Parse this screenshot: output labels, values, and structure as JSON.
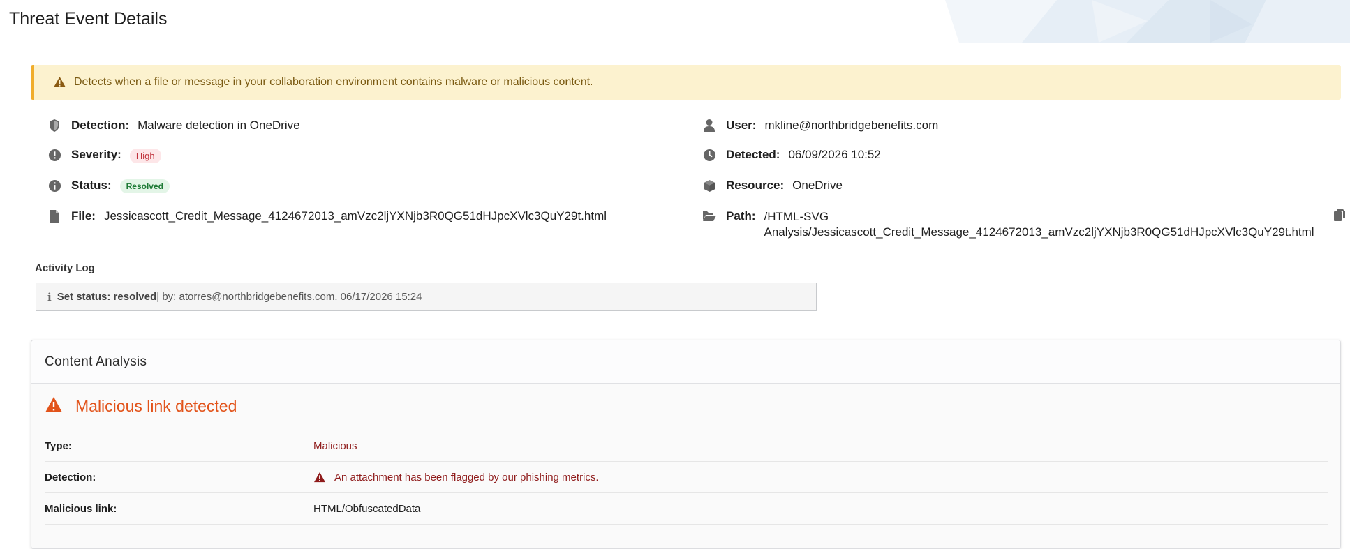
{
  "header": {
    "title": "Threat Event Details"
  },
  "alert": {
    "icon": "warning-triangle-icon",
    "text": "Detects when a file or message in your collaboration environment contains malware or malicious content."
  },
  "details": {
    "detection": {
      "label": "Detection:",
      "value": "Malware detection in OneDrive",
      "icon": "shield-icon"
    },
    "severity": {
      "label": "Severity:",
      "value": "High",
      "icon": "exclamation-circle-icon"
    },
    "status": {
      "label": "Status:",
      "value": "Resolved",
      "icon": "info-circle-icon"
    },
    "file": {
      "label": "File:",
      "value": "Jessicascott_Credit_Message_4124672013_amVzc2ljYXNjb3R0QG51dHJpcXVlc3QuY29t.html",
      "icon": "file-icon"
    },
    "user": {
      "label": "User:",
      "value": "mkline@northbridgebenefits.com",
      "icon": "user-icon"
    },
    "detected": {
      "label": "Detected:",
      "value": "06/09/2026 10:52",
      "icon": "clock-icon"
    },
    "resource": {
      "label": "Resource:",
      "value": "OneDrive",
      "icon": "cube-icon"
    },
    "path": {
      "label": "Path:",
      "line1": "/HTML-SVG",
      "line2": "Analysis/Jessicascott_Credit_Message_4124672013_amVzc2ljYXNjb3R0QG51dHJpcXVlc3QuY29t.html",
      "icon": "folder-open-icon"
    }
  },
  "activity_log": {
    "title": "Activity Log",
    "entries": [
      {
        "action": "Set status: resolved",
        "detail": " | by: atorres@northbridgebenefits.com. 06/17/2026 15:24"
      }
    ]
  },
  "content_analysis": {
    "title": "Content Analysis",
    "heading": "Malicious link detected",
    "rows": [
      {
        "label": "Type:",
        "value": "Malicious"
      },
      {
        "label": "Detection:",
        "value": "An attachment has been flagged by our phishing metrics."
      },
      {
        "label": "Malicious link:",
        "value": "HTML/ObfuscatedData"
      }
    ]
  },
  "colors": {
    "alert_bg": "#fcf2cf",
    "alert_border": "#f0ad2c",
    "danger_orange": "#e2531a",
    "danger_red": "#8f1b1b",
    "badge_high": "#c0313b",
    "badge_resolved": "#1d7a35"
  }
}
